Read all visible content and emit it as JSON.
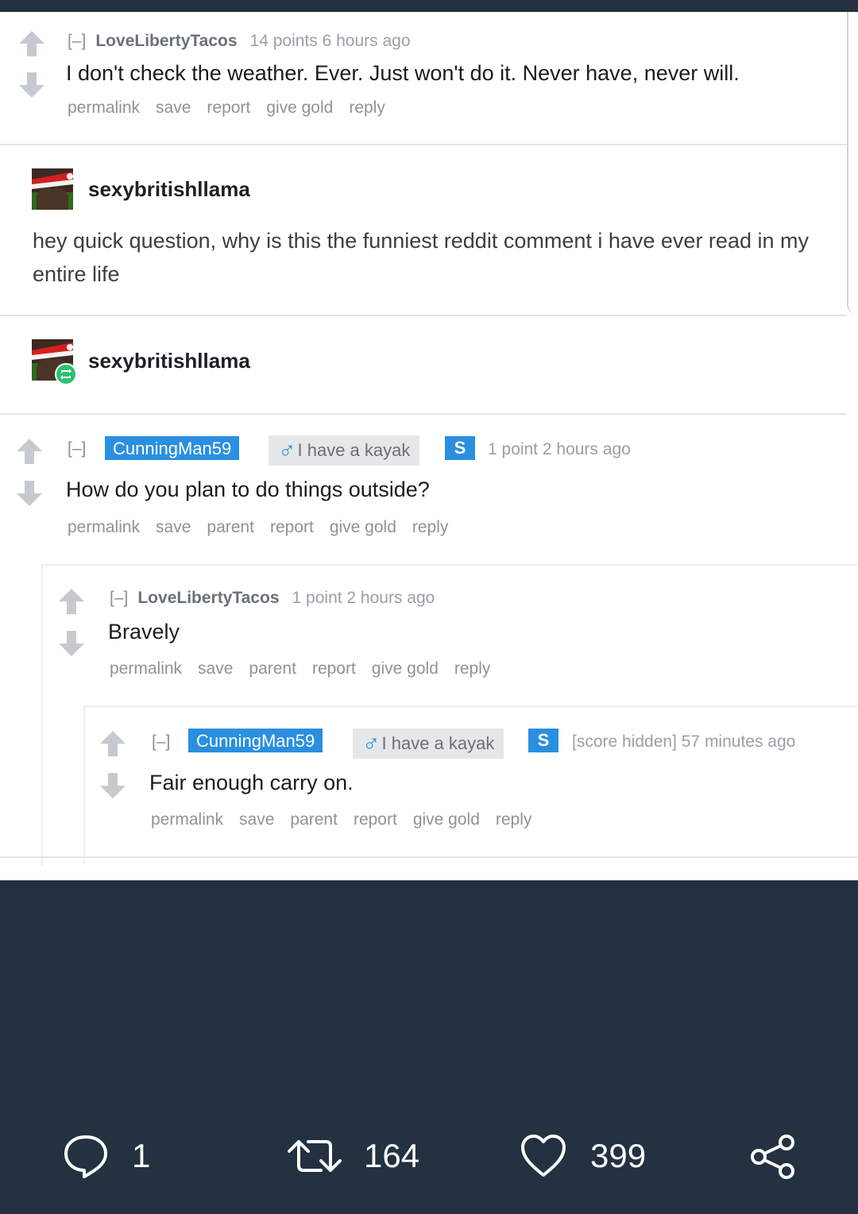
{
  "comment1": {
    "collapse": "[–]",
    "author": "LoveLibertyTacos",
    "score": "14 points 6 hours ago",
    "text": "I don't check the weather. Ever. Just won't do it. Never have, never will.",
    "actions": [
      "permalink",
      "save",
      "report",
      "give gold",
      "reply"
    ]
  },
  "tweet1": {
    "username": "sexybritishllama",
    "text": "hey quick question, why is this the funniest reddit comment i have ever read in my entire life"
  },
  "tweet2": {
    "username": "sexybritishllama"
  },
  "comment2": {
    "collapse": "[–]",
    "author": "CunningMan59",
    "flair_symbol": "♂",
    "flair": "I have a kayak",
    "badge": "S",
    "score": "1 point 2 hours ago",
    "text": "How do you plan to do things outside?",
    "actions": [
      "permalink",
      "save",
      "parent",
      "report",
      "give gold",
      "reply"
    ]
  },
  "comment3": {
    "collapse": "[–]",
    "author": "LoveLibertyTacos",
    "score": "1 point 2 hours ago",
    "text": "Bravely",
    "actions": [
      "permalink",
      "save",
      "parent",
      "report",
      "give gold",
      "reply"
    ]
  },
  "comment4": {
    "collapse": "[–]",
    "author": "CunningMan59",
    "flair_symbol": "♂",
    "flair": "I have a kayak",
    "badge": "S",
    "score": "[score hidden] 57 minutes ago",
    "text": "Fair enough carry on.",
    "actions": [
      "permalink",
      "save",
      "parent",
      "report",
      "give gold",
      "reply"
    ]
  },
  "bottom_bar": {
    "reply_icon": "speech-bubble-icon",
    "reply_count": "1",
    "retweet_icon": "retweet-icon",
    "retweet_count": "164",
    "like_icon": "heart-icon",
    "like_count": "399",
    "share_icon": "share-icon"
  },
  "colors": {
    "background": "#233140",
    "username_badge": "#2b8fe0",
    "arrow": "#c6cacf"
  }
}
